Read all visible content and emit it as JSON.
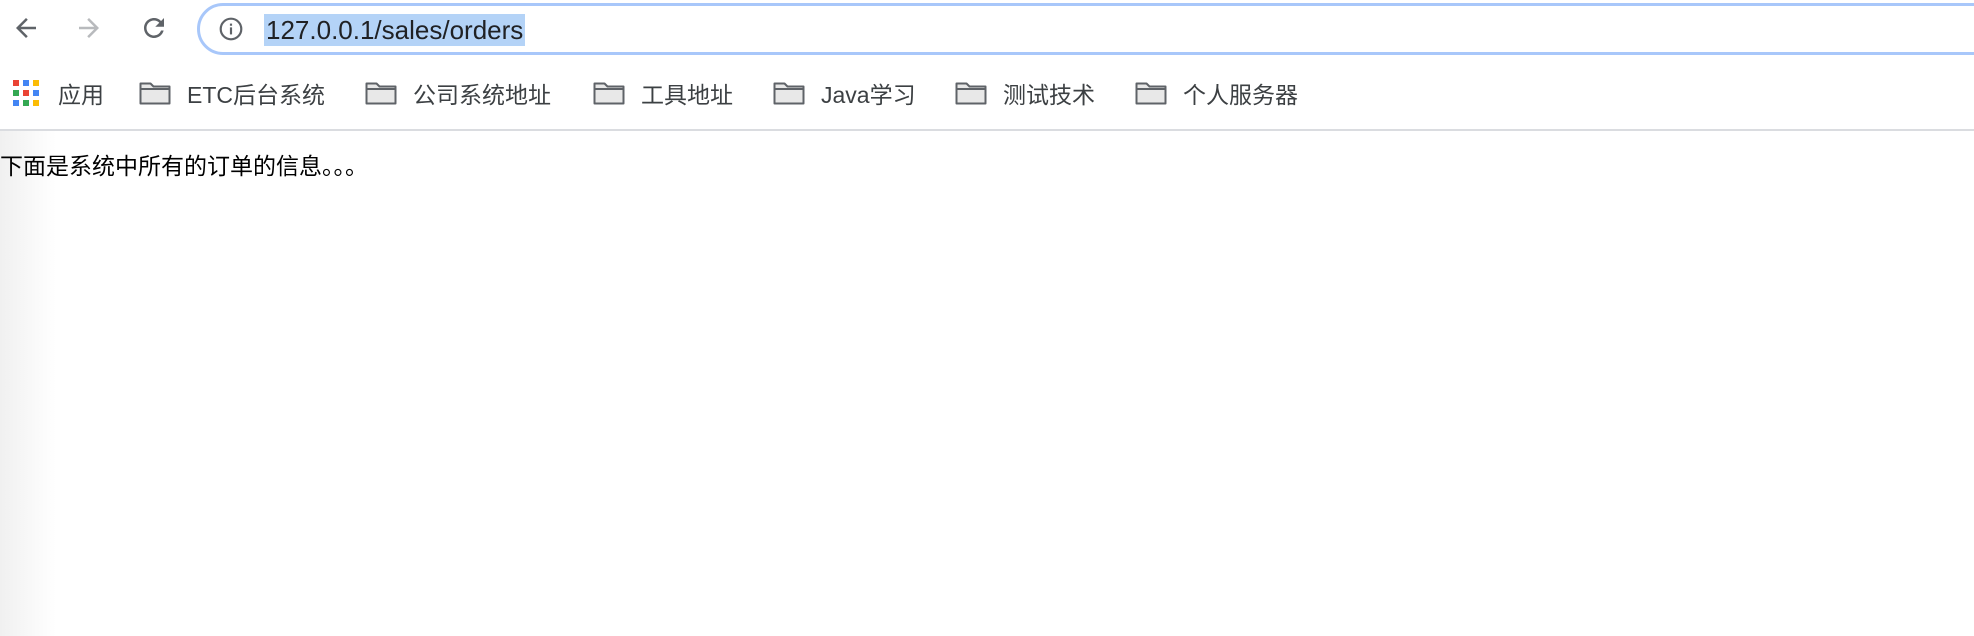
{
  "toolbar": {
    "back_icon": "arrow-left-icon",
    "forward_icon": "arrow-right-icon",
    "reload_icon": "reload-icon",
    "info_icon": "info-circle-icon",
    "url": "127.0.0.1/sales/orders",
    "url_selected": true,
    "forward_enabled": false
  },
  "bookmarks": {
    "apps": {
      "icon": "apps-grid-icon",
      "label": "应用"
    },
    "items": [
      {
        "icon": "folder-icon",
        "label": "ETC后台系统"
      },
      {
        "icon": "folder-icon",
        "label": "公司系统地址"
      },
      {
        "icon": "folder-icon",
        "label": "工具地址"
      },
      {
        "icon": "folder-icon",
        "label": "Java学习"
      },
      {
        "icon": "folder-icon",
        "label": "测试技术"
      },
      {
        "icon": "folder-icon",
        "label": "个人服务器"
      }
    ]
  },
  "page": {
    "message": "下面是系统中所有的订单的信息。。。"
  },
  "colors": {
    "omnibox_border": "#a8c7fa",
    "selection": "#b4d3f7",
    "icon": "#5f6368",
    "disabled_icon": "#b8babd"
  }
}
